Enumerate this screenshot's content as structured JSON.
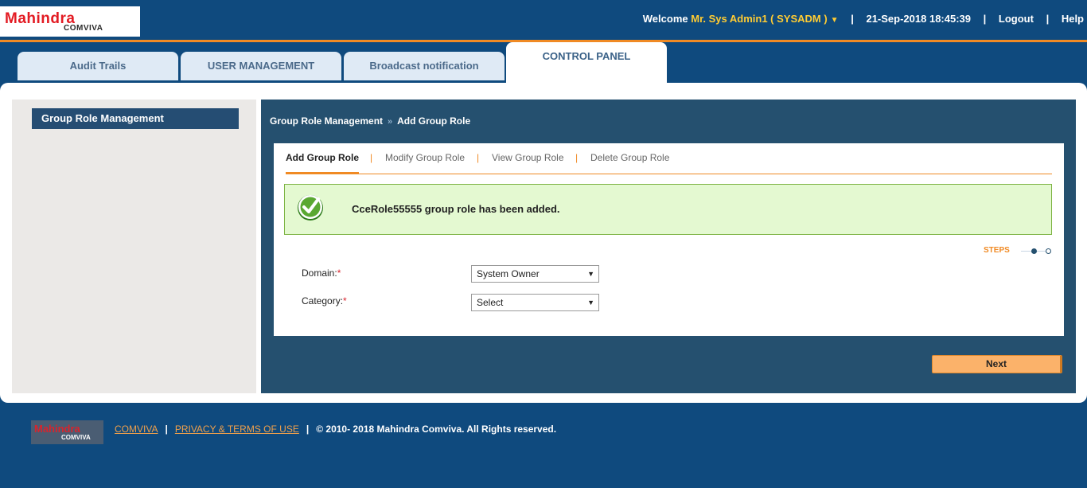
{
  "brand": {
    "logo_line1": "Mahindra",
    "logo_line2": "COMVIVA"
  },
  "header": {
    "welcome": "Welcome",
    "user": "Mr. Sys Admin1 ( SYSADM )",
    "datetime": "21-Sep-2018 18:45:39",
    "logout": "Logout",
    "help": "Help"
  },
  "tabs": [
    {
      "label": "Audit Trails"
    },
    {
      "label": "USER MANAGEMENT"
    },
    {
      "label": "Broadcast notification"
    },
    {
      "label": "CONTROL PANEL",
      "active": true
    }
  ],
  "sidebar": {
    "items": [
      {
        "label": "Group Role Management"
      }
    ]
  },
  "breadcrumb": {
    "parent": "Group Role Management",
    "current": "Add Group Role"
  },
  "subtabs": [
    {
      "label": "Add Group Role",
      "active": true
    },
    {
      "label": "Modify Group Role"
    },
    {
      "label": "View Group Role"
    },
    {
      "label": "Delete Group Role"
    }
  ],
  "message": {
    "text": "CceRole55555 group role has been added."
  },
  "steps": {
    "label": "STEPS"
  },
  "form": {
    "domain": {
      "label": "Domain:",
      "value": "System Owner"
    },
    "category": {
      "label": "Category:",
      "value": "Select"
    }
  },
  "actions": {
    "next": "Next"
  },
  "footer": {
    "comviva": "COMVIVA",
    "privacy": "PRIVACY & TERMS OF USE",
    "copyright": "© 2010- 2018   Mahindra Comviva. All Rights reserved."
  },
  "colors": {
    "accent": "#f08a24",
    "navy": "#0f4a7e",
    "panel": "#25506f",
    "success_bg": "#e4f9d1"
  }
}
